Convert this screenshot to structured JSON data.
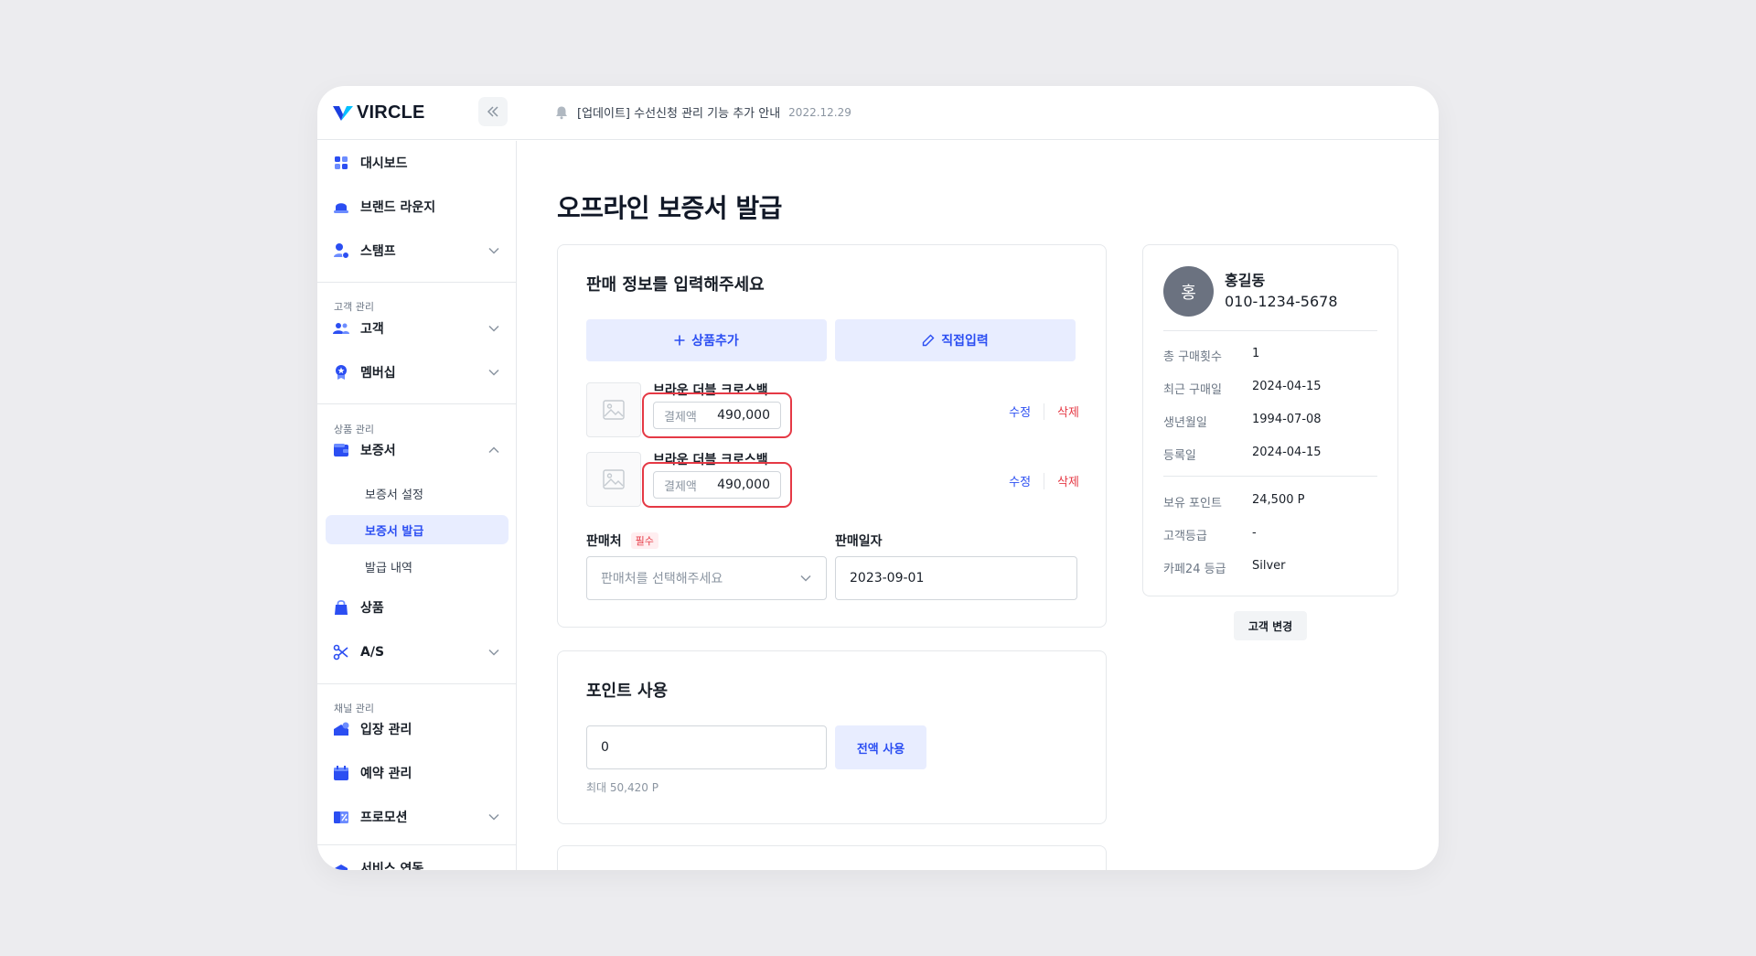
{
  "app": {
    "brand": "VIRCLE",
    "notice_text": "[업데이트] 수선신청 관리 기능 추가 안내",
    "notice_date": "2022.12.29"
  },
  "sidebar": {
    "items": [
      {
        "label": "대시보드",
        "icon": "dashboard-icon"
      },
      {
        "label": "브랜드 라운지",
        "icon": "lounge-icon"
      },
      {
        "label": "스탬프",
        "icon": "stamp-icon"
      }
    ],
    "sections": {
      "customer": "고객 관리",
      "product": "상품 관리",
      "channel": "채널 관리"
    },
    "customer_items": [
      {
        "label": "고객",
        "icon": "customer-icon"
      },
      {
        "label": "멤버십",
        "icon": "membership-icon"
      }
    ],
    "product_items": [
      {
        "label": "보증서",
        "icon": "wallet-icon"
      },
      {
        "label": "상품",
        "icon": "bag-icon"
      },
      {
        "label": "A/S",
        "icon": "scissors-icon"
      }
    ],
    "warranty_sub": [
      "보증서 설정",
      "보증서 발급",
      "발급 내역"
    ],
    "channel_items": [
      {
        "label": "입장 관리",
        "icon": "entry-icon"
      },
      {
        "label": "예약 관리",
        "icon": "calendar-icon"
      },
      {
        "label": "프로모션",
        "icon": "promotion-icon"
      },
      {
        "label": "서비스 연동",
        "icon": "service-icon"
      }
    ]
  },
  "main": {
    "title": "오프라인 보증서 발급",
    "sales_card": {
      "title": "판매 정보를 입력해주세요",
      "add_product": "상품추가",
      "direct_input": "직접입력",
      "products": [
        {
          "name": "브라운 더블 크로스백",
          "price_label": "결제액",
          "price": "490,000",
          "edit": "수정",
          "delete": "삭제"
        },
        {
          "name": "브라운 더블 크로스백",
          "price_label": "결제액",
          "price": "490,000",
          "edit": "수정",
          "delete": "삭제"
        }
      ],
      "seller_label": "판매처",
      "required": "필수",
      "seller_placeholder": "판매처를 선택해주세요",
      "date_label": "판매일자",
      "date_value": "2023-09-01"
    },
    "point_card": {
      "title": "포인트 사용",
      "value": "0",
      "use_all": "전액 사용",
      "max_text": "최대 50,420 P"
    }
  },
  "customer": {
    "avatar": "홍",
    "name": "홍길동",
    "phone": "010-1234-5678",
    "info": [
      {
        "key": "총 구매횟수",
        "value": "1"
      },
      {
        "key": "최근 구매일",
        "value": "2024-04-15"
      },
      {
        "key": "생년월일",
        "value": "1994-07-08"
      },
      {
        "key": "등록일",
        "value": "2024-04-15"
      }
    ],
    "info2": [
      {
        "key": "보유 포인트",
        "value": "24,500 P"
      },
      {
        "key": "고객등급",
        "value": "-"
      },
      {
        "key": "카페24 등급",
        "value": "Silver"
      }
    ],
    "change_button": "고객 변경"
  },
  "colors": {
    "accent": "#2B4EF2",
    "danger": "#E53945",
    "accent_bg": "#E8EDFF"
  }
}
